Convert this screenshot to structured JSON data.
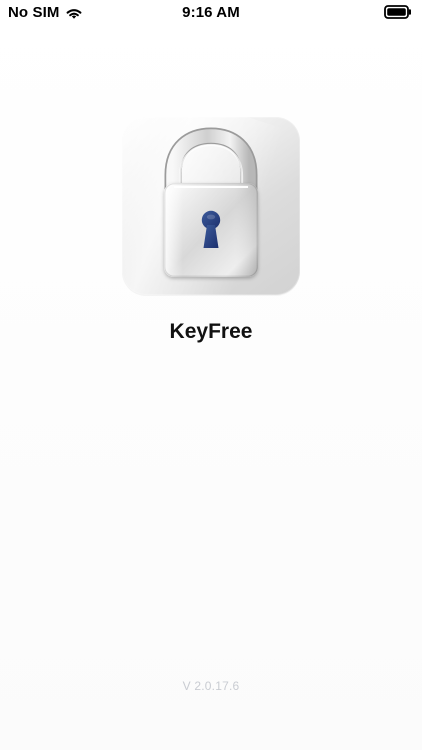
{
  "status_bar": {
    "carrier": "No SIM",
    "time": "9:16 AM",
    "icons": {
      "wifi": "wifi-icon",
      "battery": "battery-icon"
    }
  },
  "app": {
    "name": "KeyFree",
    "logo_icon": "padlock-icon",
    "version": "V 2.0.17.6"
  },
  "colors": {
    "background": "#FFFFFF",
    "title": "#111111",
    "version": "#C9CCD2",
    "logo_card": "#E5E5E5",
    "keyhole": "#1F3C88"
  }
}
